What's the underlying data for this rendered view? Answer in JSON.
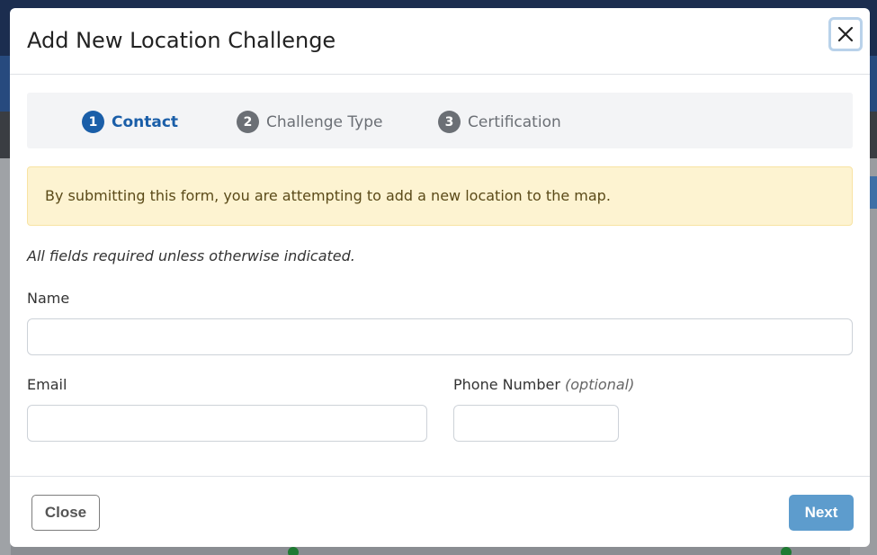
{
  "dialog": {
    "title": "Add New Location Challenge",
    "close_icon": "close-icon"
  },
  "steps": [
    {
      "number": "1",
      "label": "Contact",
      "active": true,
      "color": "#1a5ea8"
    },
    {
      "number": "2",
      "label": "Challenge Type",
      "active": false,
      "color": "#6b6f75"
    },
    {
      "number": "3",
      "label": "Certification",
      "active": false,
      "color": "#6b6f75"
    }
  ],
  "alert": {
    "text": "By submitting this form, you are attempting to add a new location to the map."
  },
  "form": {
    "hint": "All fields required unless otherwise indicated.",
    "name": {
      "label": "Name",
      "value": ""
    },
    "email": {
      "label": "Email",
      "value": ""
    },
    "phone": {
      "label": "Phone Number",
      "optional": "(optional)",
      "value": ""
    }
  },
  "footer": {
    "close_label": "Close",
    "next_label": "Next"
  },
  "colors": {
    "accent": "#1a5ea8",
    "next_button": "#5d9ccd",
    "alert_bg": "#fdf3d1"
  }
}
